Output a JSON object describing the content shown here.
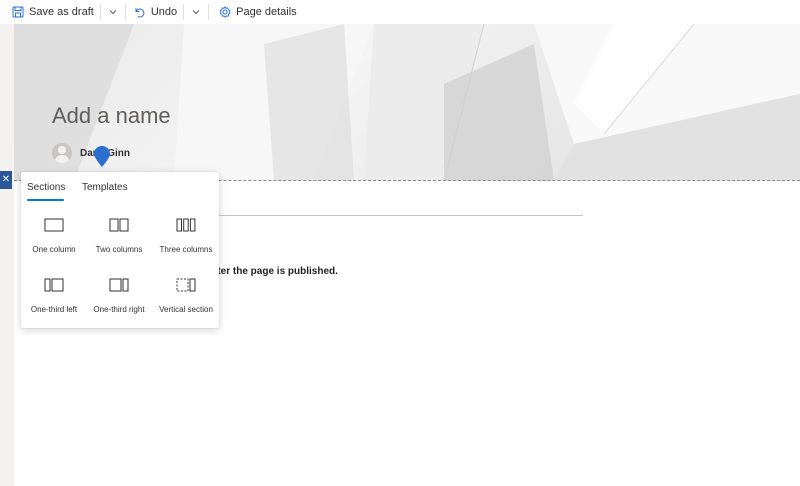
{
  "toolbar": {
    "save_label": "Save as draft",
    "undo_label": "Undo",
    "page_details_label": "Page details"
  },
  "hero": {
    "title_placeholder": "Add a name",
    "author": "Dana Ginn"
  },
  "body": {
    "text": "fter the page is published."
  },
  "panel": {
    "tabs": [
      {
        "label": "Sections",
        "selected": true
      },
      {
        "label": "Templates",
        "selected": false
      }
    ],
    "options": [
      {
        "label": "One column",
        "icon": "one-column-icon"
      },
      {
        "label": "Two columns",
        "icon": "two-columns-icon"
      },
      {
        "label": "Three columns",
        "icon": "three-columns-icon"
      },
      {
        "label": "One-third left",
        "icon": "one-third-left-icon"
      },
      {
        "label": "One-third right",
        "icon": "one-third-right-icon"
      },
      {
        "label": "Vertical section",
        "icon": "vertical-section-icon"
      }
    ]
  },
  "colors": {
    "accent": "#0078d4",
    "rail_button": "#2b579a",
    "marker": "#2b6fcf"
  }
}
